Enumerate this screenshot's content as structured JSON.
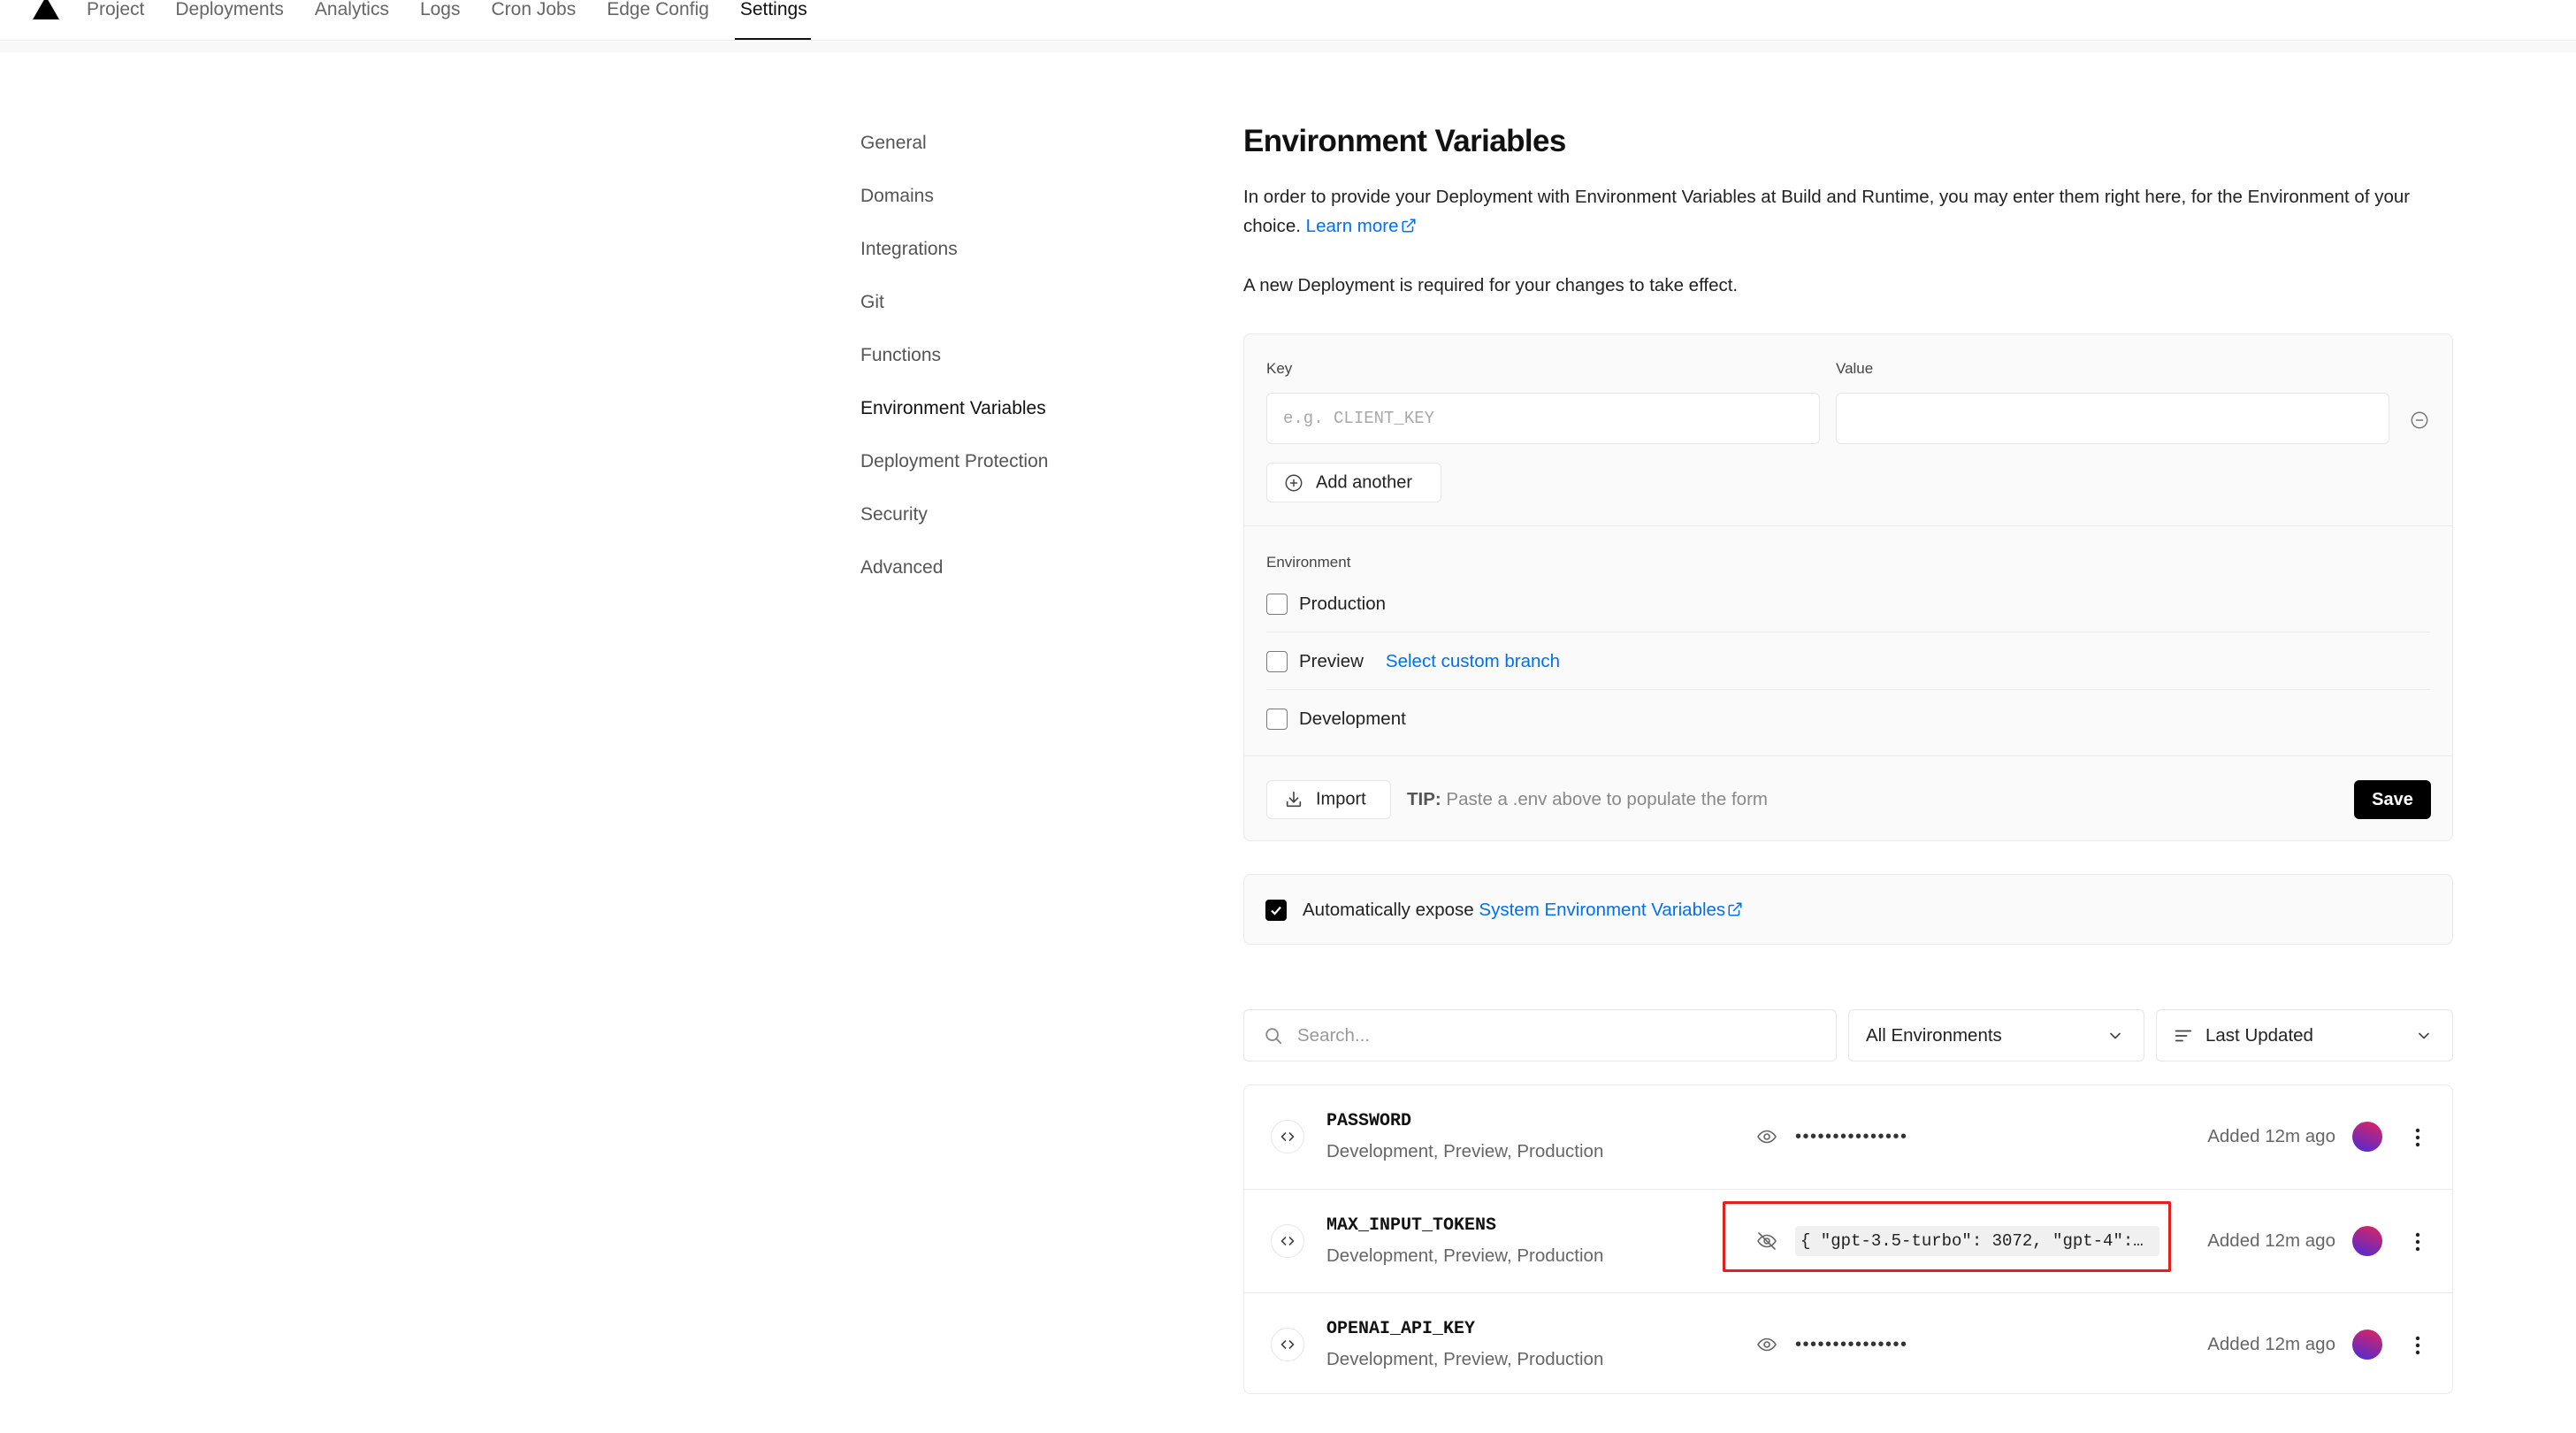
{
  "nav": {
    "tabs": [
      "Project",
      "Deployments",
      "Analytics",
      "Logs",
      "Cron Jobs",
      "Edge Config",
      "Settings"
    ],
    "active_tab": "Settings",
    "logo_icon": "triangle-logo-icon"
  },
  "sidebar": {
    "items": [
      "General",
      "Domains",
      "Integrations",
      "Git",
      "Functions",
      "Environment Variables",
      "Deployment Protection",
      "Security",
      "Advanced"
    ],
    "active": "Environment Variables"
  },
  "main": {
    "title": "Environment Variables",
    "intro": "In order to provide your Deployment with Environment Variables at Build and Runtime, you may enter them right here, for the Environment of your choice.",
    "learn_more": "Learn more",
    "notice": "A new Deployment is required for your changes to take effect."
  },
  "form": {
    "key_label": "Key",
    "key_placeholder": "e.g. CLIENT_KEY",
    "key_value": "",
    "value_label": "Value",
    "value_value": "",
    "add_another": "Add another",
    "environment_label": "Environment",
    "environments": [
      {
        "label": "Production",
        "checked": false
      },
      {
        "label": "Preview",
        "checked": false,
        "link": "Select custom branch"
      },
      {
        "label": "Development",
        "checked": false
      }
    ],
    "import_label": "Import",
    "tip_prefix": "TIP:",
    "tip_text": "Paste a .env above to populate the form",
    "save_label": "Save"
  },
  "auto_expose": {
    "checked": true,
    "text": "Automatically expose",
    "link": "System Environment Variables"
  },
  "filters": {
    "search_placeholder": "Search...",
    "environment_select": "All Environments",
    "sort_select": "Last Updated"
  },
  "variables": [
    {
      "name": "PASSWORD",
      "environments": "Development, Preview, Production",
      "value": "•••••••••••••••",
      "value_visible": false,
      "added": "Added 12m ago"
    },
    {
      "name": "MAX_INPUT_TOKENS",
      "environments": "Development, Preview, Production",
      "value": "{ \"gpt-3.5-turbo\": 3072, \"gpt-4\":…",
      "value_visible": true,
      "added": "Added 12m ago"
    },
    {
      "name": "OPENAI_API_KEY",
      "environments": "Development, Preview, Production",
      "value": "•••••••••••••••",
      "value_visible": false,
      "added": "Added 12m ago"
    }
  ],
  "colors": {
    "link": "#0070f3",
    "primary_button": "#000000",
    "highlight": "#e3201b",
    "avatar_gradient": [
      "#e0245e",
      "#4b2bd6"
    ]
  }
}
